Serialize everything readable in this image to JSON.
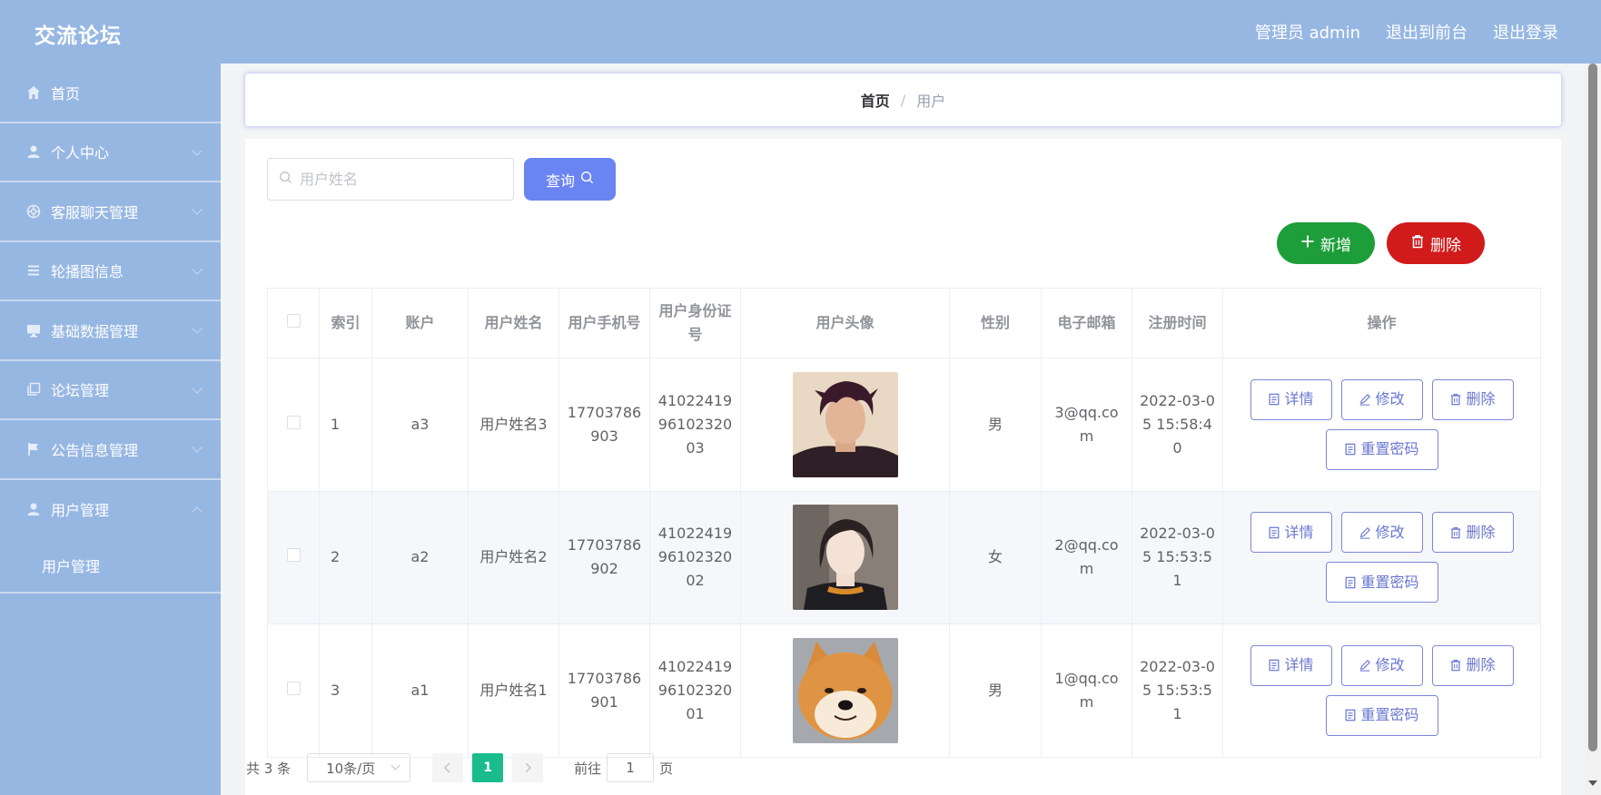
{
  "header": {
    "app_title": "交流论坛",
    "admin_label": "管理员 admin",
    "back_to_front": "退出到前台",
    "logout": "退出登录"
  },
  "sidebar": {
    "items": [
      {
        "label": "首页",
        "icon": "home-icon"
      },
      {
        "label": "个人中心",
        "icon": "user-icon"
      },
      {
        "label": "客服聊天管理",
        "icon": "help-icon"
      },
      {
        "label": "轮播图信息",
        "icon": "menu-icon"
      },
      {
        "label": "基础数据管理",
        "icon": "monitor-icon"
      },
      {
        "label": "论坛管理",
        "icon": "copy-icon"
      },
      {
        "label": "公告信息管理",
        "icon": "flag-icon"
      },
      {
        "label": "用户管理",
        "icon": "user-icon"
      }
    ],
    "sub_item": "用户管理"
  },
  "breadcrumb": {
    "home": "首页",
    "separator": "/",
    "current": "用户"
  },
  "search": {
    "placeholder": "用户姓名",
    "value": "",
    "query_label": "查询"
  },
  "actions": {
    "add_label": "新增",
    "delete_label": "删除"
  },
  "table": {
    "headers": [
      "索引",
      "账户",
      "用户姓名",
      "用户手机号",
      "用户身份证号",
      "用户头像",
      "性别",
      "电子邮箱",
      "注册时间",
      "操作"
    ],
    "rows": [
      {
        "index": "1",
        "account": "a3",
        "name": "用户姓名3",
        "phone": "17703786903",
        "id_card": "410224199610232003",
        "avatar": "avatar-young-man",
        "gender": "男",
        "email": "3@qq.com",
        "reg_time": "2022-03-05 15:58:40"
      },
      {
        "index": "2",
        "account": "a2",
        "name": "用户姓名2",
        "phone": "17703786902",
        "id_card": "410224199610232002",
        "avatar": "avatar-young-woman",
        "gender": "女",
        "email": "2@qq.com",
        "reg_time": "2022-03-05 15:53:51"
      },
      {
        "index": "3",
        "account": "a1",
        "name": "用户姓名1",
        "phone": "17703786901",
        "id_card": "410224199610232001",
        "avatar": "avatar-shiba-dog",
        "gender": "男",
        "email": "1@qq.com",
        "reg_time": "2022-03-05 15:53:51"
      }
    ],
    "op_detail": "详情",
    "op_edit": "修改",
    "op_delete": "删除",
    "op_reset_pwd": "重置密码"
  },
  "pagination": {
    "total": "共 3 条",
    "page_size": "10条/页",
    "current_page": "1",
    "goto_label": "前往",
    "goto_value": "1",
    "page_unit": "页"
  },
  "colors": {
    "header_bg": "#97b7e3",
    "query_button": "#6a84f2",
    "add_button": "#1e9e3a",
    "delete_button": "#d11a1a",
    "active_page": "#1abc8c"
  }
}
